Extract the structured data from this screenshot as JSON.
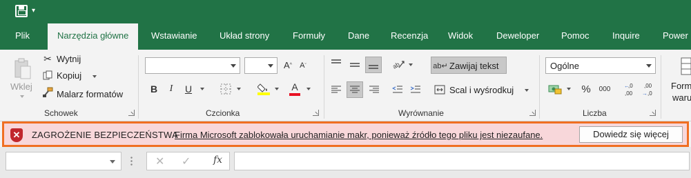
{
  "quick_access": {
    "save_icon": "save-icon",
    "dropdown_icon": "customize-dropdown-icon"
  },
  "tabs": [
    {
      "label": "Plik"
    },
    {
      "label": "Narzędzia główne",
      "active": true
    },
    {
      "label": "Wstawianie"
    },
    {
      "label": "Układ strony"
    },
    {
      "label": "Formuły"
    },
    {
      "label": "Dane"
    },
    {
      "label": "Recenzja"
    },
    {
      "label": "Widok"
    },
    {
      "label": "Deweloper"
    },
    {
      "label": "Pomoc"
    },
    {
      "label": "Inquire"
    },
    {
      "label": "Power"
    }
  ],
  "clipboard": {
    "paste_label": "Wklej",
    "cut_label": "Wytnij",
    "copy_label": "Kopiuj",
    "format_painter_label": "Malarz formatów",
    "group_label": "Schowek"
  },
  "font": {
    "font_name": "",
    "font_size": "",
    "bold": "B",
    "italic": "I",
    "underline": "U",
    "group_label": "Czcionka",
    "font_color": "#e81123",
    "highlight_color": "#ffff00"
  },
  "alignment": {
    "wrap_text_label": "Zawijaj tekst",
    "merge_center_label": "Scal i wyśrodkuj",
    "group_label": "Wyrównanie"
  },
  "number": {
    "format_value": "Ogólne",
    "percent": "%",
    "thousands": "000",
    "increase_decimal": "←,0\n,00",
    "decrease_decimal": ",00\n→,0",
    "group_label": "Liczba"
  },
  "styles": {
    "partial_label_1": "Form",
    "partial_label_2": "waru"
  },
  "security_bar": {
    "title": "ZAGROŻENIE BEZPIECZEŃSTWA",
    "message": "Firma Microsoft zablokowała uruchamianie makr, ponieważ źródło tego pliku jest niezaufane.",
    "button_label": "Dowiedz się więcej",
    "accent_color": "#c1272d",
    "background_color": "#f8d7da"
  },
  "formula_bar": {
    "name_box_value": "",
    "cancel_symbol": "✕",
    "enter_symbol": "✓",
    "fx_label": "fx",
    "formula_value": ""
  },
  "colors": {
    "brand": "#217346",
    "highlight_border": "#f06f22"
  }
}
